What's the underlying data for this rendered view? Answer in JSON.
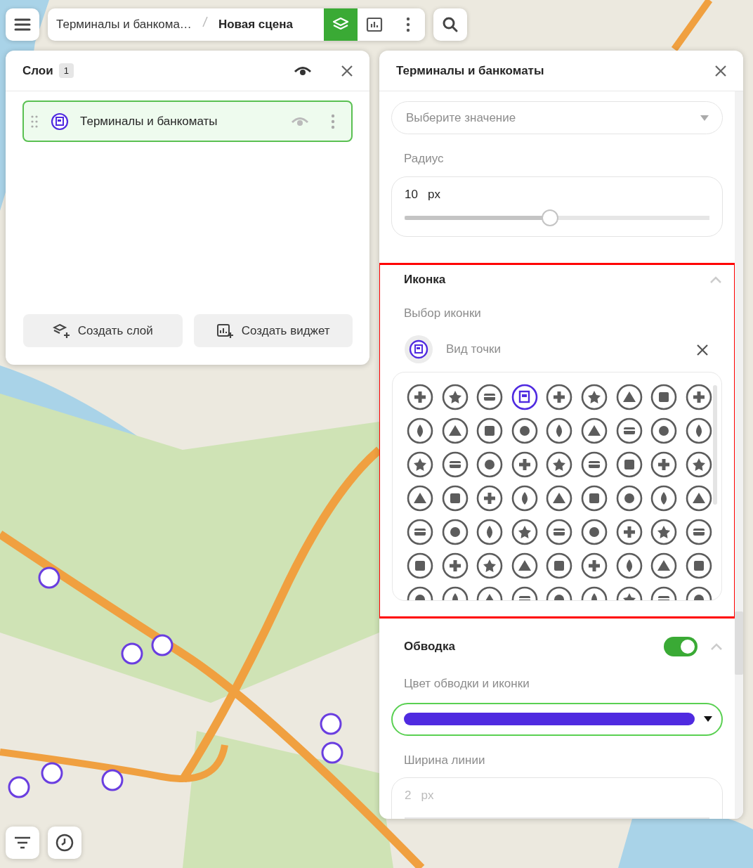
{
  "toolbar": {
    "breadcrumb": [
      "Терминалы и банкома…",
      "Новая сцена"
    ],
    "view_buttons": [
      {
        "kind": "layers",
        "selected": true
      },
      {
        "kind": "chart",
        "selected": false
      }
    ]
  },
  "layers_panel": {
    "title": "Слои",
    "count": "1",
    "items": [
      {
        "name": "Терминалы и банкоматы",
        "selected": true
      }
    ],
    "buttons": [
      {
        "kind": "layer",
        "label": "Создать слой"
      },
      {
        "kind": "widget",
        "label": "Создать виджет"
      }
    ]
  },
  "settings_panel": {
    "title": "Терминалы и банкоматы",
    "select": {
      "placeholder": "Выберите значение"
    },
    "radius": {
      "label": "Радиус",
      "value": "10",
      "unit": "px",
      "level": 0.475
    },
    "icon_section": {
      "title": "Иконка",
      "expanded": true,
      "label": "Выбор иконки",
      "chosen": "Вид точки",
      "icons": [
        {
          "selected": false
        },
        {
          "selected": false
        },
        {
          "selected": false
        },
        {
          "selected": true
        },
        {
          "selected": false
        },
        {
          "selected": false
        },
        {
          "selected": false
        },
        {
          "selected": false
        },
        {
          "selected": false
        },
        {
          "selected": false
        },
        {
          "selected": false
        },
        {
          "selected": false
        },
        {
          "selected": false
        },
        {
          "selected": false
        },
        {
          "selected": false
        },
        {
          "selected": false
        },
        {
          "selected": false
        },
        {
          "selected": false
        },
        {
          "selected": false
        },
        {
          "selected": false
        },
        {
          "selected": false
        },
        {
          "selected": false
        },
        {
          "selected": false
        },
        {
          "selected": false
        },
        {
          "selected": false
        },
        {
          "selected": false
        },
        {
          "selected": false
        },
        {
          "selected": false
        },
        {
          "selected": false
        },
        {
          "selected": false
        },
        {
          "selected": false
        },
        {
          "selected": false
        },
        {
          "selected": false
        },
        {
          "selected": false
        },
        {
          "selected": false
        },
        {
          "selected": false
        },
        {
          "selected": false
        },
        {
          "selected": false
        },
        {
          "selected": false
        },
        {
          "selected": false
        },
        {
          "selected": false
        },
        {
          "selected": false
        },
        {
          "selected": false
        },
        {
          "selected": false
        },
        {
          "selected": false
        },
        {
          "selected": false
        },
        {
          "selected": false
        },
        {
          "selected": false
        },
        {
          "selected": false
        },
        {
          "selected": false
        },
        {
          "selected": false
        },
        {
          "selected": false
        },
        {
          "selected": false
        },
        {
          "selected": false
        },
        {
          "selected": false
        },
        {
          "selected": false
        },
        {
          "selected": false
        },
        {
          "selected": false
        },
        {
          "selected": false
        },
        {
          "selected": false
        },
        {
          "selected": false
        },
        {
          "selected": false
        },
        {
          "selected": false
        }
      ]
    },
    "stroke": {
      "title": "Обводка",
      "on": true,
      "expanded": true,
      "color_label": "Цвет обводки и иконки",
      "color": "#4f2ae0",
      "width_label": "Ширина линии",
      "width_value": "2",
      "width_unit": "px",
      "disabled": true
    }
  }
}
